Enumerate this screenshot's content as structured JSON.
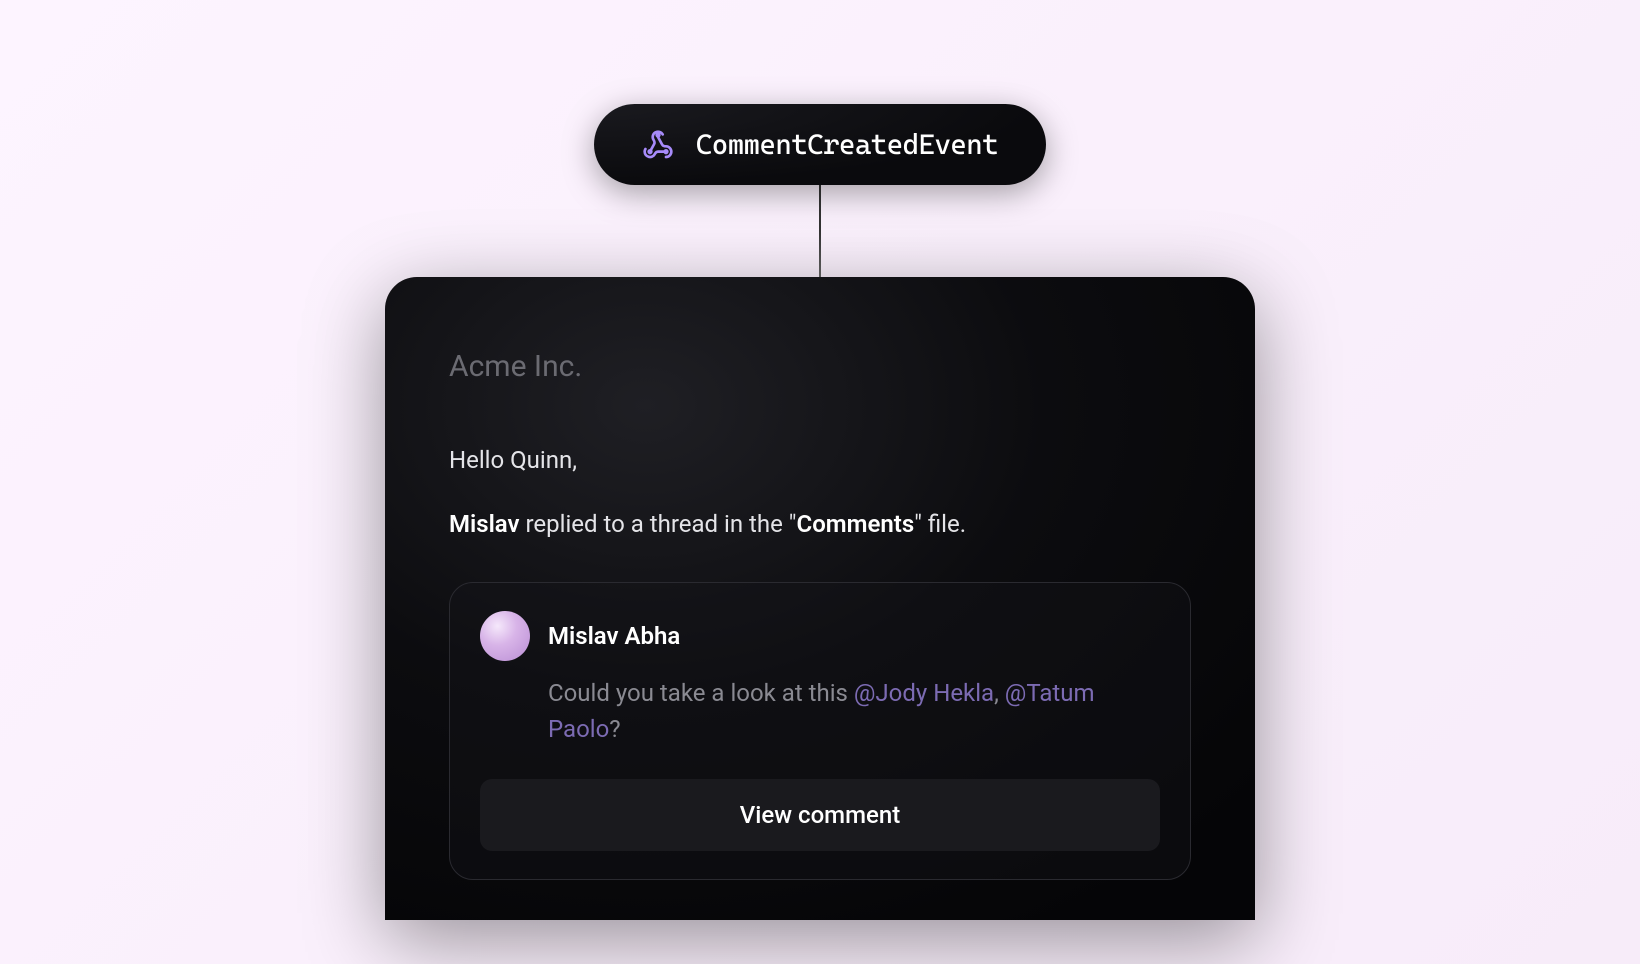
{
  "event": {
    "name": "CommentCreatedEvent",
    "icon": "webhook-icon"
  },
  "email": {
    "company": "Acme Inc.",
    "greeting": "Hello Quinn,",
    "activity": {
      "actor": "Mislav",
      "middle": " replied to a thread in the \"",
      "file": "Comments",
      "suffix": "\" file."
    },
    "comment": {
      "author": "Mislav Abha",
      "body_prefix": "Could you take a look at this ",
      "mention1": "@Jody Hekla",
      "separator": ", ",
      "mention2": "@Tatum Paolo",
      "body_suffix": "?"
    },
    "cta": "View comment"
  }
}
